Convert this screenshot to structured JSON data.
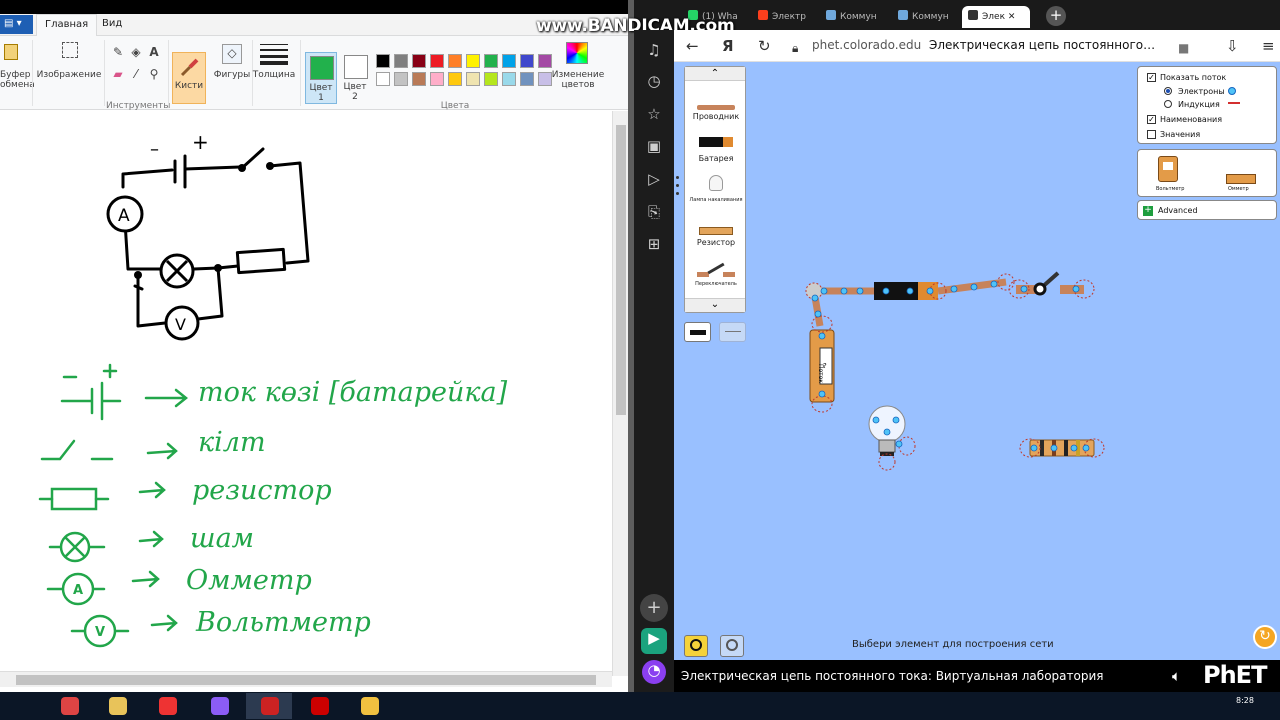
{
  "watermark": "www.BANDICAM.com",
  "paint": {
    "tabs": {
      "home": "Главная",
      "view": "Вид"
    },
    "ribbon": {
      "clipboard": "Буфер обмена",
      "image": "Изображение",
      "tools_group": "Инструменты",
      "brushes": "Кисти",
      "shapes": "Фигуры",
      "thickness": "Толщина",
      "color1": "Цвет 1",
      "color2": "Цвет 2",
      "colors_group": "Цвета",
      "edit_colors": "Изменение цветов"
    },
    "palette_row1": [
      "#000000",
      "#7f7f7f",
      "#880015",
      "#ed1c24",
      "#ff7f27",
      "#fff200",
      "#22b14c",
      "#00a2e8",
      "#3f48cc",
      "#a349a4"
    ],
    "palette_row2": [
      "#ffffff",
      "#c3c3c3",
      "#b97a57",
      "#ffaec9",
      "#ffc90e",
      "#efe4b0",
      "#b5e61d",
      "#99d9ea",
      "#7092be",
      "#c8bfe7"
    ],
    "color1_value": "#22b14c",
    "color2_value": "#ffffff",
    "drawing": {
      "schematic_labels": {
        "minus": "–",
        "plus": "+",
        "ammeter": "A",
        "voltmeter": "V"
      },
      "legend": [
        {
          "text": "ток көзі [батарейка]"
        },
        {
          "text": "кілт"
        },
        {
          "text": "резистор"
        },
        {
          "text": "шам"
        },
        {
          "text": "Омметр"
        },
        {
          "text": "Вольтметр"
        }
      ],
      "legend_symbols": {
        "ammeter": "A",
        "voltmeter": "V"
      },
      "ink_color": "#22a64a"
    }
  },
  "browser": {
    "tabs": [
      {
        "label": "(1) Wha",
        "active": false
      },
      {
        "label": "Электр",
        "active": false
      },
      {
        "label": "Коммун",
        "active": false
      },
      {
        "label": "Коммун",
        "active": false
      },
      {
        "label": "Элек",
        "active": true
      }
    ],
    "url": "phet.colorado.edu",
    "page_title": "Электрическая цепь постоянного…",
    "sim": {
      "carousel": [
        "Проводник",
        "Батарея",
        "Лампа накаливания",
        "Резистор",
        "Переключатель"
      ],
      "view_panel": {
        "show_current": "Показать поток",
        "electrons": "Электроны",
        "conventional": "Индукция",
        "labels": "Наименования",
        "values": "Значения",
        "show_current_checked": true,
        "electrons_selected": true,
        "labels_checked": true,
        "values_checked": false
      },
      "tools": {
        "voltmeter": "Вольтметр",
        "ammeter": "Омметр"
      },
      "advanced": "Advanced",
      "hint": "Выбери элемент для построения сети",
      "ammeter_label": "Поток",
      "ammeter_value": "?",
      "title": "Электрическая цепь постоянного тока: Виртуальная лаборатория",
      "logo": "PhET"
    }
  },
  "taskbar": {
    "time": "8:28"
  }
}
